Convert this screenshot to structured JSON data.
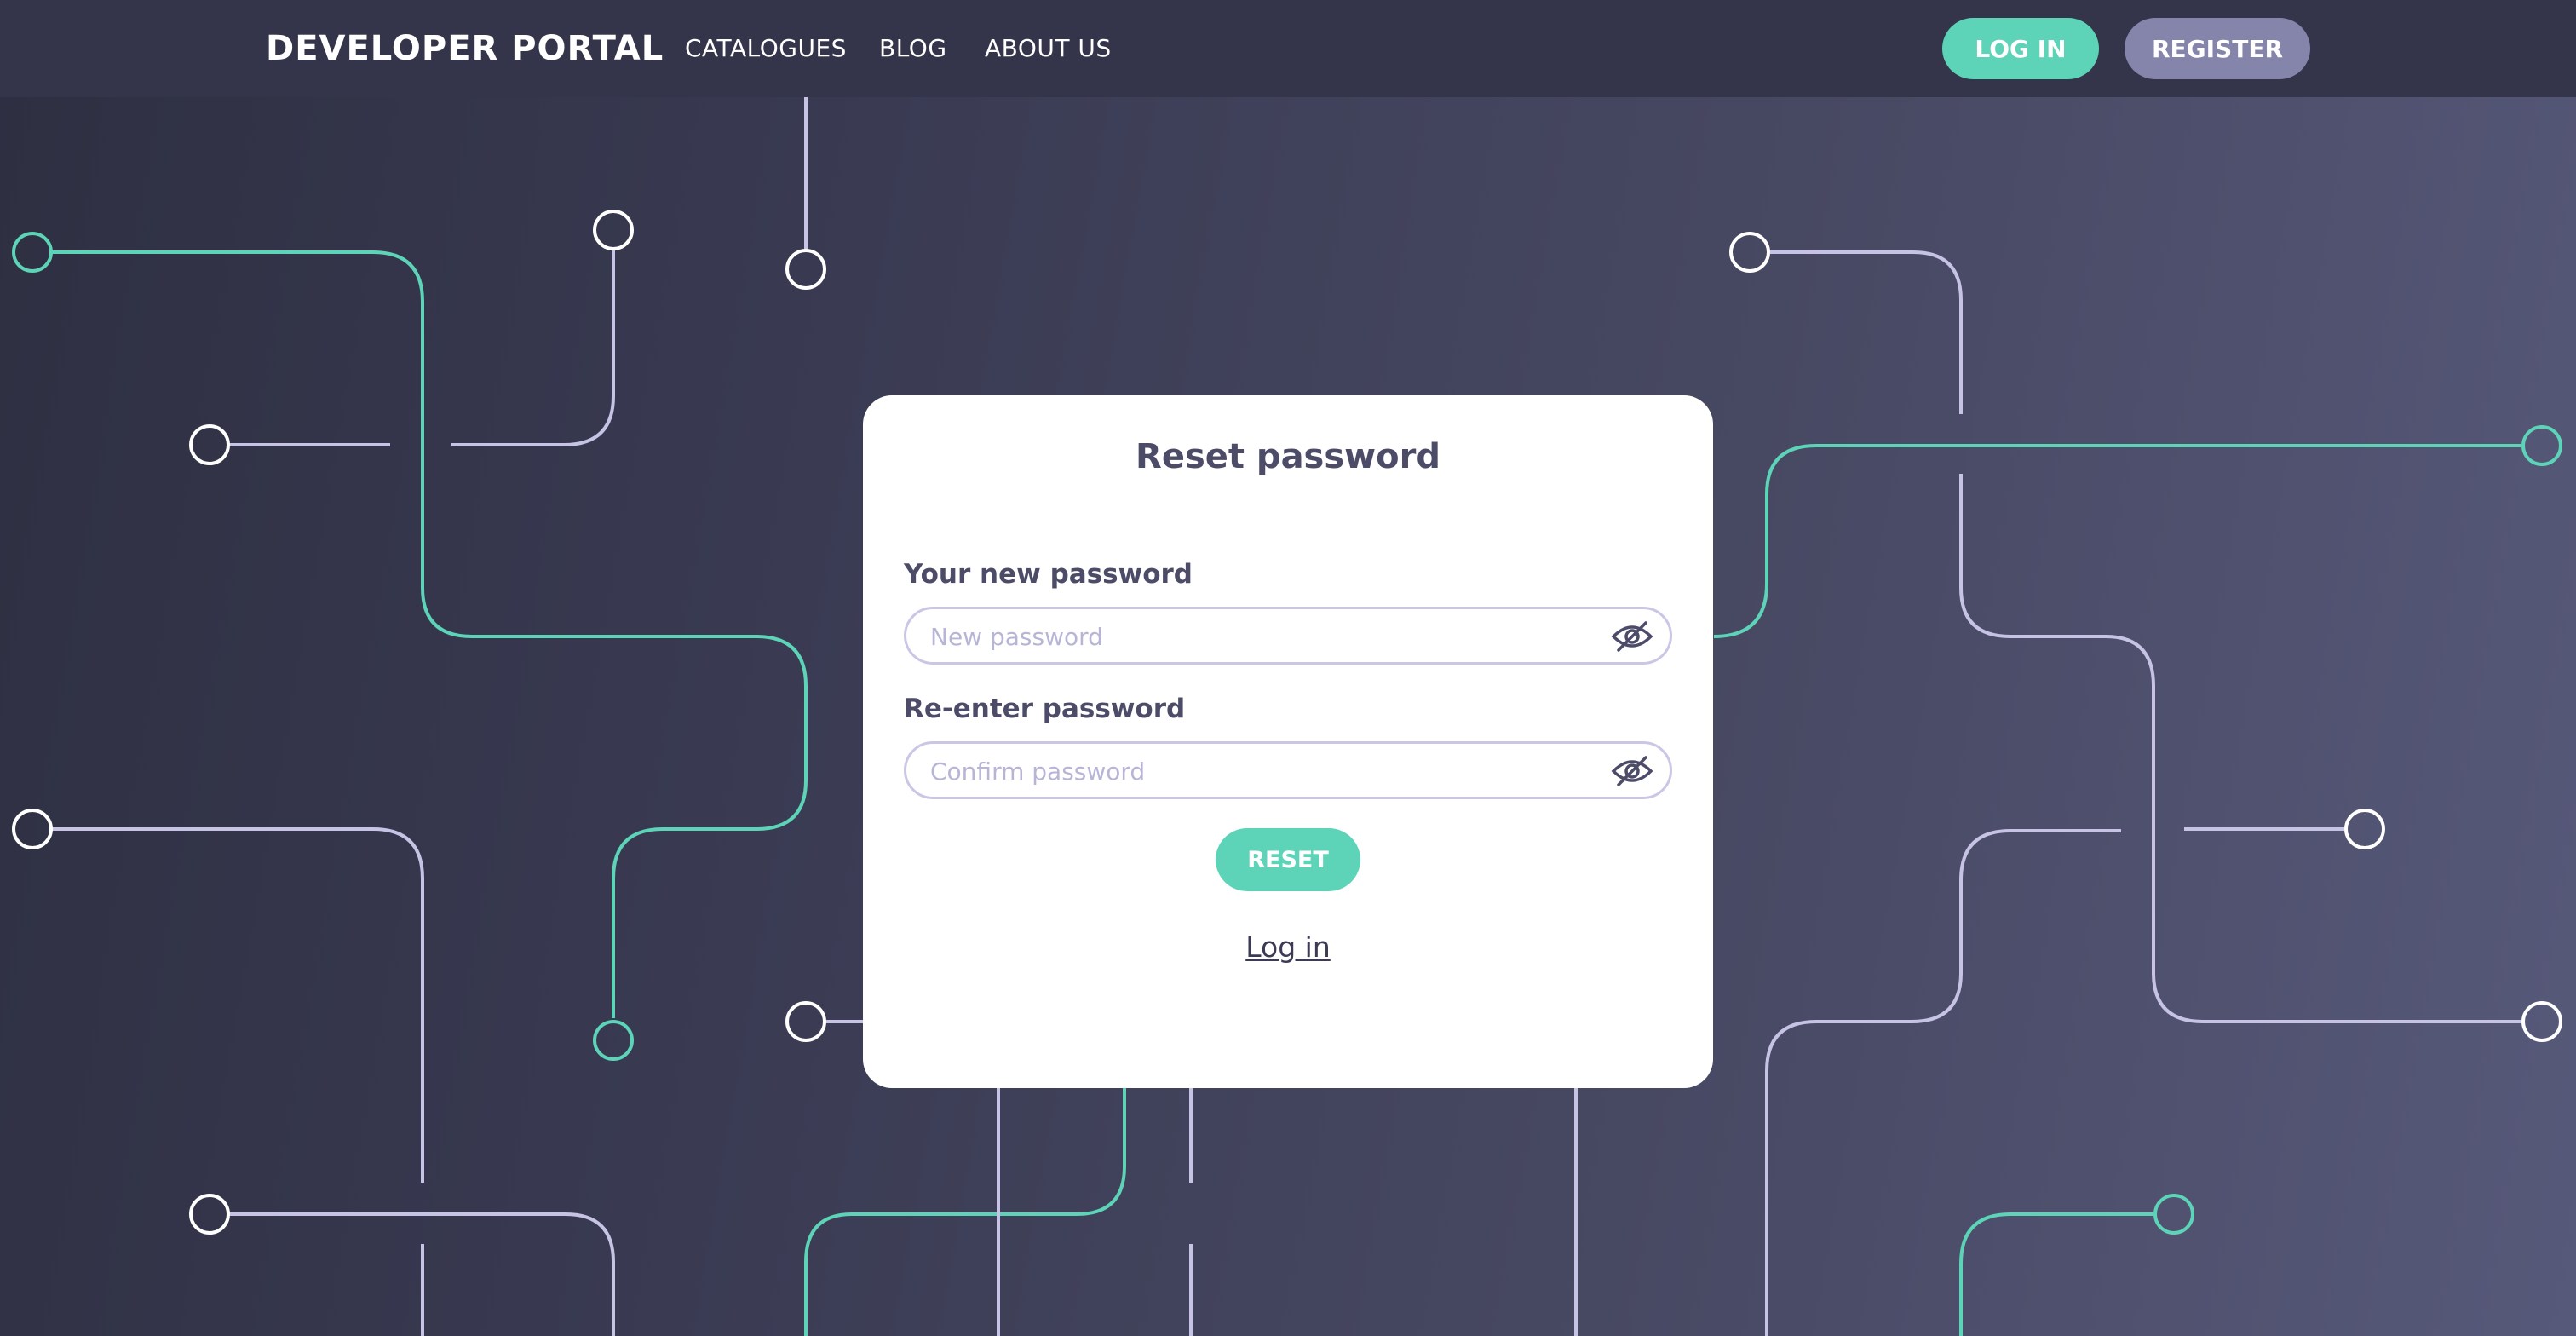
{
  "nav": {
    "brand": "DEVELOPER PORTAL",
    "links": [
      "CATALOGUES",
      "BLOG",
      "ABOUT US"
    ],
    "login_label": "LOG IN",
    "register_label": "REGISTER"
  },
  "form": {
    "title": "Reset password",
    "new_password": {
      "label": "Your new password",
      "placeholder": "New password",
      "icon": "eye-slash-icon"
    },
    "confirm_password": {
      "label": "Re-enter password",
      "placeholder": "Confirm password",
      "icon": "eye-slash-icon"
    },
    "reset_label": "RESET",
    "login_link": "Log in"
  },
  "colors": {
    "accent": "#5dd3b8",
    "secondary": "#8584aa",
    "navbar": "#34354a",
    "circuit_light": "#c6c3e5",
    "text_dark": "#4d4c68"
  }
}
